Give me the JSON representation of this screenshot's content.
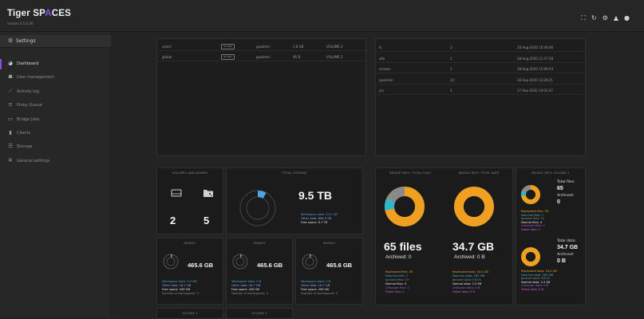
{
  "app": {
    "name_prefix": "Tiger SP",
    "name_logo": "A",
    "name_suffix": "CES",
    "version": "version 4.5.0.46"
  },
  "top_icons": [
    "network-icon",
    "refresh-icon",
    "settings-icon",
    "alert-icon",
    "user-icon"
  ],
  "sidebar": {
    "header": "Settings",
    "items": [
      {
        "label": "Dashboard",
        "icon": "dashboard-icon",
        "active": true
      },
      {
        "label": "User management",
        "icon": "users-icon"
      },
      {
        "label": "Activity log",
        "icon": "chart-icon"
      },
      {
        "label": "Proxy Queue",
        "icon": "list-icon"
      },
      {
        "label": "Bridge Jobs",
        "icon": "bridge-icon"
      },
      {
        "label": "Clients",
        "icon": "clients-icon"
      },
      {
        "label": "Storage",
        "icon": "storage-icon"
      },
      {
        "label": "General settings",
        "icon": "gear-icon"
      }
    ]
  },
  "workspaces_table": {
    "rows": [
      {
        "name": "smart",
        "status": "in use",
        "owner": "ppadmin",
        "size": "1.8 GB",
        "volume": "VOLUME 2"
      },
      {
        "name": "global",
        "status": "in use",
        "owner": "ppadmin",
        "size": "96 B",
        "volume": "VOLUME 2"
      }
    ]
  },
  "users_table": {
    "rows": [
      {
        "name": "fs",
        "count": "3",
        "date": "20-Aug-2020 10:49:46"
      },
      {
        "name": "olle",
        "count": "1",
        "date": "28-Aug-2020 11:37:28"
      },
      {
        "name": "simeon",
        "count": "1",
        "date": "28-Aug-2020 15:09:43"
      },
      {
        "name": "ppadmin",
        "count": "14",
        "date": "16-Sep-2020 13:28:21"
      },
      {
        "name": "jon",
        "count": "3",
        "date": "17-Sep-2020 14:02:47"
      }
    ]
  },
  "volumes_card": {
    "title": "VOLUMES AND SHARES",
    "volumes": "2",
    "shares": "5"
  },
  "total_storage": {
    "title": "TOTAL STORAGE",
    "value": "9.5 TB",
    "workspace": "Workspace data: 23.2 GB",
    "other": "Other data: 884.3 GB",
    "free": "Free space: 8.7 TB"
  },
  "shares": [
    {
      "title": "SHARE1",
      "value": "465.6 GB",
      "workspace": "Workspace data: 5.9 MB",
      "other": "Other data: 16.7 GB",
      "free": "Free space: 449 GB",
      "count": "Number of workspaces: 3"
    },
    {
      "title": "SHARE2",
      "value": "465.6 GB",
      "workspace": "Workspace data: 0 B",
      "other": "Other data: 16.7 GB",
      "free": "Free space: 449 GB",
      "count": "Number of workspaces: 0"
    },
    {
      "title": "SHARE3",
      "value": "465.6 GB",
      "workspace": "Workspace data: 0 B",
      "other": "Other data: 16.7 GB",
      "free": "Free space: 449 GB",
      "count": "Number of workspaces: 0"
    }
  ],
  "bottom_volumes": [
    "VOLUME 1",
    "VOLUME 2"
  ],
  "bridge_files": {
    "title": "BRIDGE INFO: TOTAL FILES",
    "value": "65 files",
    "archived": "Archived: 0",
    "replicated": "Replicated files: 35",
    "nearline": "Nearline files: 7",
    "ignored": "Ignored files: 19",
    "normal": "Normal files: 4",
    "unknown": "Unknown files: 0",
    "failed": "Failed files: 0"
  },
  "bridge_data": {
    "title": "BRIDGE INFO: TOTAL DATA",
    "value": "34.7 GB",
    "archived": "Archived: 0 B",
    "replicated": "Replicated data: 34.4 GB",
    "nearline": "Nearline data: 285 MB",
    "ignored": "Ignored data: 645 B",
    "normal": "Normal data: 2.5 KB",
    "unknown": "Unknown data: 0 B",
    "failed": "Failed data: 0 B"
  },
  "bridge_volume": {
    "title": "BRIDGE INFO: VOLUME 2",
    "files_label": "Total files:",
    "files_value": "65",
    "archived_label": "Archived:",
    "archived_value": "0",
    "replicated": "Replicated files: 35",
    "nearline": "Nearline files: 7",
    "ignored": "Ignored files: 19",
    "normal": "Normal files: 4",
    "unknown": "Unknown files: 0",
    "failed": "Failed files: 0",
    "data_label": "Total data:",
    "data_value": "34.7 GB",
    "darchived_label": "Archived:",
    "darchived_value": "0 B",
    "dreplicated": "Replicated data: 34.4 GB",
    "dnearline": "Nearline data: 285 MB",
    "dignored": "Ignored data: 645 B",
    "dnormal": "Normal data: 2.5 KB",
    "dunknown": "Unknown data: 0 B",
    "dfailed": "Failed data: 0 B"
  },
  "colors": {
    "accent": "#8a4fe0",
    "workspace": "#4da3e0",
    "replicated": "#f0a020",
    "nearline": "#2fb8c8",
    "ignored": "#8a8a8a"
  }
}
